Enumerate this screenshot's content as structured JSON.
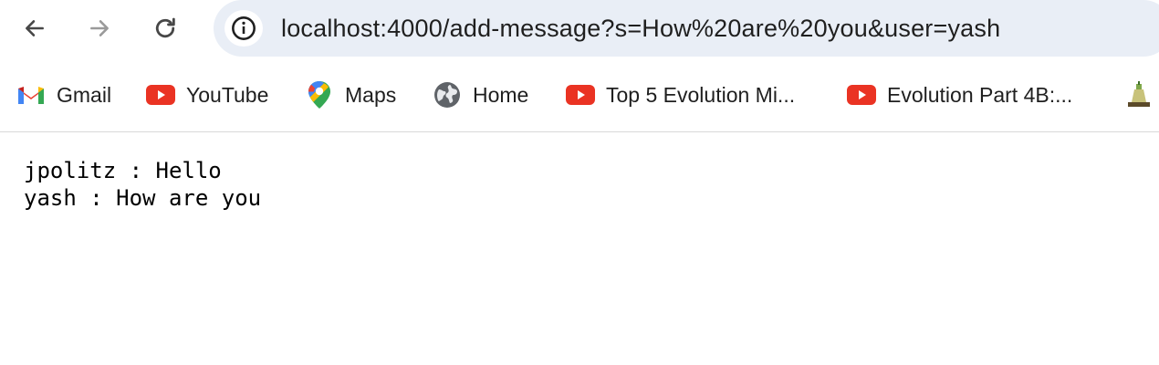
{
  "browser": {
    "url": "localhost:4000/add-message?s=How%20are%20you&user=yash"
  },
  "bookmarks": [
    {
      "label": "Gmail",
      "icon": "gmail-icon"
    },
    {
      "label": "YouTube",
      "icon": "youtube-icon"
    },
    {
      "label": "Maps",
      "icon": "maps-icon"
    },
    {
      "label": "Home",
      "icon": "globe-icon"
    },
    {
      "label": "Top 5 Evolution Mi...",
      "icon": "youtube-icon"
    },
    {
      "label": "Evolution Part 4B:...",
      "icon": "youtube-icon"
    }
  ],
  "messages": [
    "jpolitz : Hello",
    "yash : How are you"
  ],
  "colors": {
    "omnibox_bg": "#e9eef6",
    "youtube_red": "#ea3323",
    "text": "#1f1f1f"
  }
}
